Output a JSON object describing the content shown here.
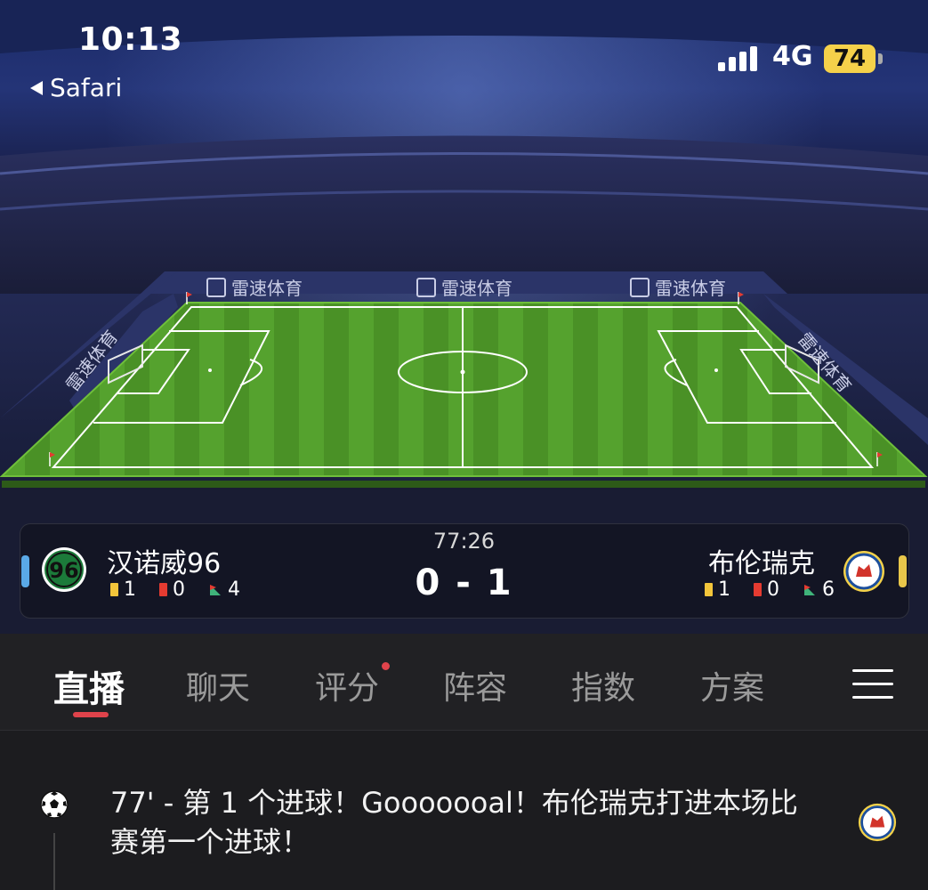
{
  "status_bar": {
    "time": "10:13",
    "back_app": "Safari",
    "network": "4G",
    "battery": "74"
  },
  "pitch": {
    "sponsor": "雷速体育"
  },
  "match": {
    "clock": "77:26",
    "score": "0 - 1",
    "home": {
      "name": "汉诺威96",
      "logo_text": "96",
      "yellow_cards": "1",
      "red_cards": "0",
      "corners": "4",
      "color": "#5aa9e6"
    },
    "away": {
      "name": "布伦瑞克",
      "yellow_cards": "1",
      "red_cards": "0",
      "corners": "6",
      "color": "#e9c74a"
    }
  },
  "tabs": [
    {
      "label": "直播",
      "active": true
    },
    {
      "label": "聊天"
    },
    {
      "label": "评分",
      "has_badge": true
    },
    {
      "label": "阵容"
    },
    {
      "label": "指数"
    },
    {
      "label": "方案"
    }
  ],
  "feed": {
    "events": [
      {
        "text": "77' - 第 1 个进球！Gooooooal！布伦瑞克打进本场比赛第一个进球！",
        "icon": "soccer-ball-icon"
      }
    ]
  },
  "colors": {
    "accent": "#e0434b",
    "pitch_green": "#4f9a2a"
  }
}
